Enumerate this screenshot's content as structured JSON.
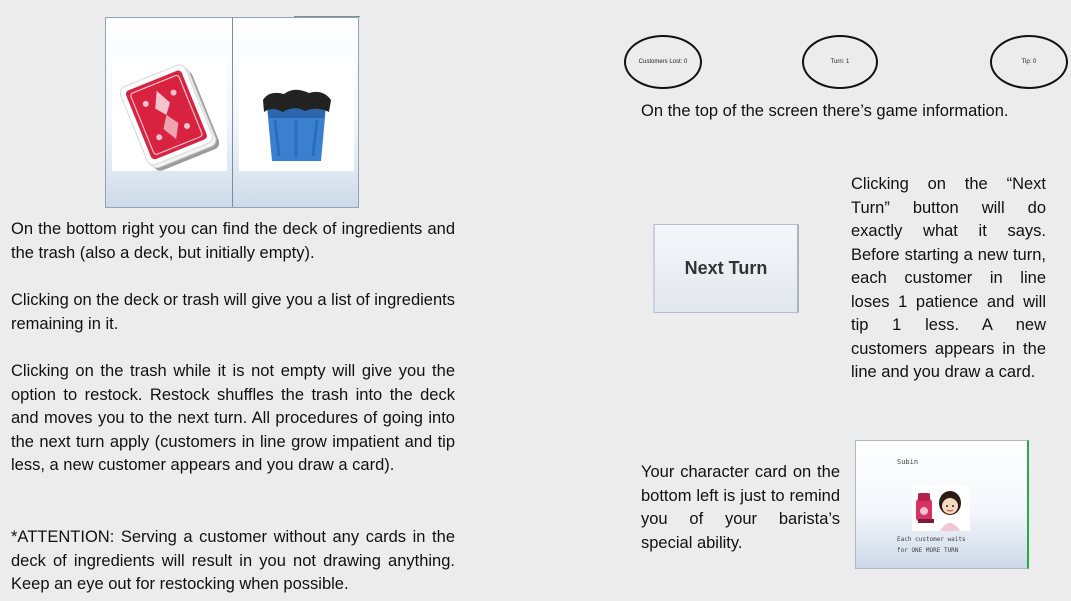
{
  "game_info": {
    "customers_lost": "Customers Lost: 0",
    "turn": "Turn: 1",
    "tip": "Tip: 0",
    "caption": "On the top of the screen there’s game information."
  },
  "deck_section": {
    "deck_icon": "playing-card-deck",
    "trash_icon": "trash-bin",
    "p1": "On the bottom right you can find the deck of ingredients and the trash (also a deck, but initially empty).",
    "p2": "Clicking on the deck or trash will give you a list of ingredients remaining in it.",
    "p3": "Clicking on the trash while it is not empty will give you the option to restock. Restock shuffles the trash into the deck and moves you to the next turn. All procedures of going into the next turn apply (customers in line grow impatient and tip less, a new customer appears and you draw a card).",
    "p4": "*ATTENTION: Serving a customer without any cards in the deck of ingredients will result in you not drawing anything. Keep an eye out for restocking when possible."
  },
  "next_turn_section": {
    "button_label": "Next Turn",
    "description": "Clicking on the “Next Turn” button will do exactly what it says. Before starting a new turn, each customer in line loses 1 patience and will tip 1 less. A new customers appears in the line and you draw a card."
  },
  "character_section": {
    "description": "Your character card on the bottom left is just to remind you of your barista’s special ability.",
    "card_name": "Subin",
    "card_ability_line1": "Each customer waits",
    "card_ability_line2": "for ONE MORE TURN"
  },
  "colors": {
    "background": "#ececec",
    "card_red": "#d8223f",
    "trash_blue": "#3a7fd0"
  }
}
